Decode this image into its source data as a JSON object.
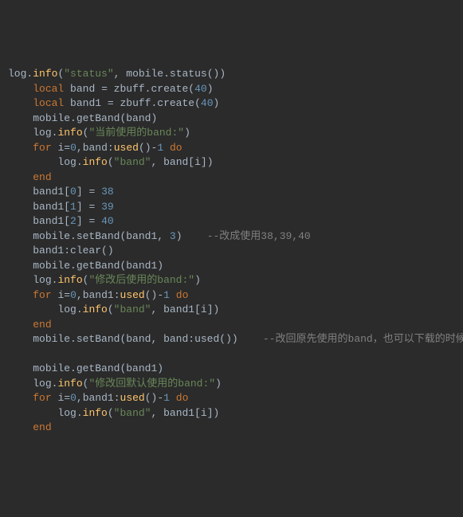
{
  "code": {
    "l1": {
      "fn": "log.info",
      "s": "\"status\"",
      "call": "mobile.status()"
    },
    "l2": {
      "kw": "local",
      "v": "band",
      "rhs": "zbuff.create",
      "n": "40"
    },
    "l3": {
      "kw": "local",
      "v": "band1",
      "rhs": "zbuff.create",
      "n": "40"
    },
    "l4": {
      "call": "mobile.getBand",
      "arg": "band"
    },
    "l5": {
      "fn": "log.info",
      "s": "\"当前使用的band:\""
    },
    "l6": {
      "kw": "for",
      "v": "i",
      "n0": "0",
      "obj": "band",
      "m": "used",
      "n1": "1",
      "kw2": "do"
    },
    "l7": {
      "fn": "log.info",
      "s": "\"band\"",
      "idx": "band[i]"
    },
    "l8": {
      "kw": "end"
    },
    "l9": {
      "lhs": "band1",
      "i": "0",
      "n": "38"
    },
    "l10": {
      "lhs": "band1",
      "i": "1",
      "n": "39"
    },
    "l11": {
      "lhs": "band1",
      "i": "2",
      "n": "40"
    },
    "l12": {
      "call": "mobile.setBand",
      "a": "band1",
      "n": "3",
      "cmt": "--改成使用38,39,40"
    },
    "l13": {
      "call": "band1:clear"
    },
    "l14": {
      "call": "mobile.getBand",
      "arg": "band1"
    },
    "l15": {
      "fn": "log.info",
      "s": "\"修改后使用的band:\""
    },
    "l16": {
      "kw": "for",
      "v": "i",
      "n0": "0",
      "obj": "band1",
      "m": "used",
      "n1": "1",
      "kw2": "do"
    },
    "l17": {
      "fn": "log.info",
      "s": "\"band\"",
      "idx": "band1[i]"
    },
    "l18": {
      "kw": "end"
    },
    "l19": {
      "call": "mobile.setBand",
      "a": "band",
      "b": "band:used()",
      "cmt": "--改回原先使用的band，也可以下载的时候选择清除fs"
    },
    "l20": {
      "call": "mobile.getBand",
      "arg": "band1"
    },
    "l21": {
      "fn": "log.info",
      "s": "\"修改回默认使用的band:\""
    },
    "l22": {
      "kw": "for",
      "v": "i",
      "n0": "0",
      "obj": "band1",
      "m": "used",
      "n1": "1",
      "kw2": "do"
    },
    "l23": {
      "fn": "log.info",
      "s": "\"band\"",
      "idx": "band1[i]"
    },
    "l24": {
      "kw": "end"
    }
  }
}
